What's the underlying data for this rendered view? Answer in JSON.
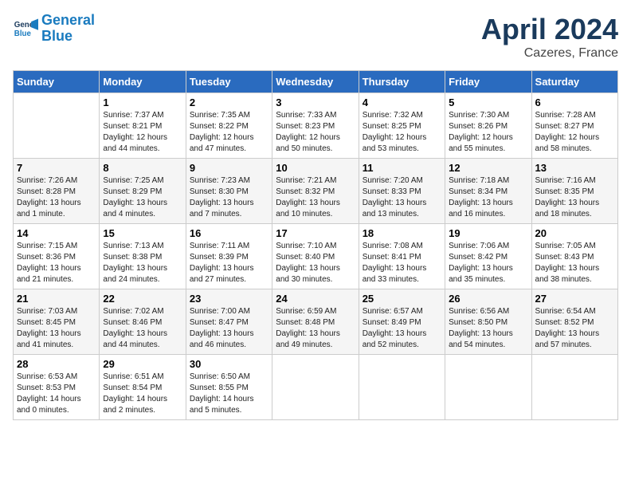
{
  "header": {
    "logo_line1": "General",
    "logo_line2": "Blue",
    "month": "April 2024",
    "location": "Cazeres, France"
  },
  "columns": [
    "Sunday",
    "Monday",
    "Tuesday",
    "Wednesday",
    "Thursday",
    "Friday",
    "Saturday"
  ],
  "weeks": [
    [
      {
        "day": "",
        "sunrise": "",
        "sunset": "",
        "daylight": ""
      },
      {
        "day": "1",
        "sunrise": "Sunrise: 7:37 AM",
        "sunset": "Sunset: 8:21 PM",
        "daylight": "Daylight: 12 hours and 44 minutes."
      },
      {
        "day": "2",
        "sunrise": "Sunrise: 7:35 AM",
        "sunset": "Sunset: 8:22 PM",
        "daylight": "Daylight: 12 hours and 47 minutes."
      },
      {
        "day": "3",
        "sunrise": "Sunrise: 7:33 AM",
        "sunset": "Sunset: 8:23 PM",
        "daylight": "Daylight: 12 hours and 50 minutes."
      },
      {
        "day": "4",
        "sunrise": "Sunrise: 7:32 AM",
        "sunset": "Sunset: 8:25 PM",
        "daylight": "Daylight: 12 hours and 53 minutes."
      },
      {
        "day": "5",
        "sunrise": "Sunrise: 7:30 AM",
        "sunset": "Sunset: 8:26 PM",
        "daylight": "Daylight: 12 hours and 55 minutes."
      },
      {
        "day": "6",
        "sunrise": "Sunrise: 7:28 AM",
        "sunset": "Sunset: 8:27 PM",
        "daylight": "Daylight: 12 hours and 58 minutes."
      }
    ],
    [
      {
        "day": "7",
        "sunrise": "Sunrise: 7:26 AM",
        "sunset": "Sunset: 8:28 PM",
        "daylight": "Daylight: 13 hours and 1 minute."
      },
      {
        "day": "8",
        "sunrise": "Sunrise: 7:25 AM",
        "sunset": "Sunset: 8:29 PM",
        "daylight": "Daylight: 13 hours and 4 minutes."
      },
      {
        "day": "9",
        "sunrise": "Sunrise: 7:23 AM",
        "sunset": "Sunset: 8:30 PM",
        "daylight": "Daylight: 13 hours and 7 minutes."
      },
      {
        "day": "10",
        "sunrise": "Sunrise: 7:21 AM",
        "sunset": "Sunset: 8:32 PM",
        "daylight": "Daylight: 13 hours and 10 minutes."
      },
      {
        "day": "11",
        "sunrise": "Sunrise: 7:20 AM",
        "sunset": "Sunset: 8:33 PM",
        "daylight": "Daylight: 13 hours and 13 minutes."
      },
      {
        "day": "12",
        "sunrise": "Sunrise: 7:18 AM",
        "sunset": "Sunset: 8:34 PM",
        "daylight": "Daylight: 13 hours and 16 minutes."
      },
      {
        "day": "13",
        "sunrise": "Sunrise: 7:16 AM",
        "sunset": "Sunset: 8:35 PM",
        "daylight": "Daylight: 13 hours and 18 minutes."
      }
    ],
    [
      {
        "day": "14",
        "sunrise": "Sunrise: 7:15 AM",
        "sunset": "Sunset: 8:36 PM",
        "daylight": "Daylight: 13 hours and 21 minutes."
      },
      {
        "day": "15",
        "sunrise": "Sunrise: 7:13 AM",
        "sunset": "Sunset: 8:38 PM",
        "daylight": "Daylight: 13 hours and 24 minutes."
      },
      {
        "day": "16",
        "sunrise": "Sunrise: 7:11 AM",
        "sunset": "Sunset: 8:39 PM",
        "daylight": "Daylight: 13 hours and 27 minutes."
      },
      {
        "day": "17",
        "sunrise": "Sunrise: 7:10 AM",
        "sunset": "Sunset: 8:40 PM",
        "daylight": "Daylight: 13 hours and 30 minutes."
      },
      {
        "day": "18",
        "sunrise": "Sunrise: 7:08 AM",
        "sunset": "Sunset: 8:41 PM",
        "daylight": "Daylight: 13 hours and 33 minutes."
      },
      {
        "day": "19",
        "sunrise": "Sunrise: 7:06 AM",
        "sunset": "Sunset: 8:42 PM",
        "daylight": "Daylight: 13 hours and 35 minutes."
      },
      {
        "day": "20",
        "sunrise": "Sunrise: 7:05 AM",
        "sunset": "Sunset: 8:43 PM",
        "daylight": "Daylight: 13 hours and 38 minutes."
      }
    ],
    [
      {
        "day": "21",
        "sunrise": "Sunrise: 7:03 AM",
        "sunset": "Sunset: 8:45 PM",
        "daylight": "Daylight: 13 hours and 41 minutes."
      },
      {
        "day": "22",
        "sunrise": "Sunrise: 7:02 AM",
        "sunset": "Sunset: 8:46 PM",
        "daylight": "Daylight: 13 hours and 44 minutes."
      },
      {
        "day": "23",
        "sunrise": "Sunrise: 7:00 AM",
        "sunset": "Sunset: 8:47 PM",
        "daylight": "Daylight: 13 hours and 46 minutes."
      },
      {
        "day": "24",
        "sunrise": "Sunrise: 6:59 AM",
        "sunset": "Sunset: 8:48 PM",
        "daylight": "Daylight: 13 hours and 49 minutes."
      },
      {
        "day": "25",
        "sunrise": "Sunrise: 6:57 AM",
        "sunset": "Sunset: 8:49 PM",
        "daylight": "Daylight: 13 hours and 52 minutes."
      },
      {
        "day": "26",
        "sunrise": "Sunrise: 6:56 AM",
        "sunset": "Sunset: 8:50 PM",
        "daylight": "Daylight: 13 hours and 54 minutes."
      },
      {
        "day": "27",
        "sunrise": "Sunrise: 6:54 AM",
        "sunset": "Sunset: 8:52 PM",
        "daylight": "Daylight: 13 hours and 57 minutes."
      }
    ],
    [
      {
        "day": "28",
        "sunrise": "Sunrise: 6:53 AM",
        "sunset": "Sunset: 8:53 PM",
        "daylight": "Daylight: 14 hours and 0 minutes."
      },
      {
        "day": "29",
        "sunrise": "Sunrise: 6:51 AM",
        "sunset": "Sunset: 8:54 PM",
        "daylight": "Daylight: 14 hours and 2 minutes."
      },
      {
        "day": "30",
        "sunrise": "Sunrise: 6:50 AM",
        "sunset": "Sunset: 8:55 PM",
        "daylight": "Daylight: 14 hours and 5 minutes."
      },
      {
        "day": "",
        "sunrise": "",
        "sunset": "",
        "daylight": ""
      },
      {
        "day": "",
        "sunrise": "",
        "sunset": "",
        "daylight": ""
      },
      {
        "day": "",
        "sunrise": "",
        "sunset": "",
        "daylight": ""
      },
      {
        "day": "",
        "sunrise": "",
        "sunset": "",
        "daylight": ""
      }
    ]
  ]
}
